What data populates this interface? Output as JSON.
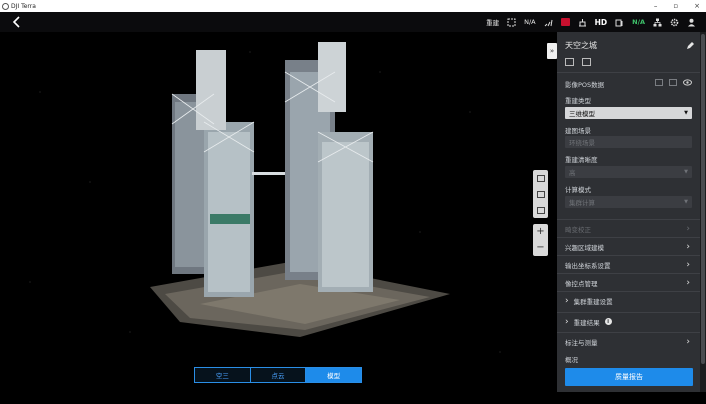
{
  "window": {
    "title": "DJI Terra",
    "controls": [
      "–",
      "▫",
      "×"
    ]
  },
  "appbar": {
    "rebuild_label": "重建",
    "status_1": "N/A",
    "hd_label": "HD",
    "status_2": "N/A",
    "icons": [
      "back-icon",
      "rtk-icon",
      "signal-icon",
      "battery-red-icon",
      "antenna-icon",
      "remote-icon",
      "network-icon",
      "gear-icon",
      "user-icon"
    ],
    "colors": {
      "warning": "#c8102e",
      "ok": "#3ec16a"
    }
  },
  "viewport": {
    "modes": [
      "空三",
      "点云",
      "模型"
    ],
    "active_mode": "模型"
  },
  "panel": {
    "title": "天空之城",
    "pos_data_label": "影像POS数据",
    "rebuild_type_label": "重建类型",
    "rebuild_type_value": "三维模型",
    "scene_label": "建图场景",
    "scene_value": "环绕场景",
    "resolution_label": "重建清晰度",
    "resolution_value": "高",
    "compute_label": "计算模式",
    "compute_value": "集群计算",
    "items": [
      {
        "label": "畸变校正",
        "enabled": false
      },
      {
        "label": "兴趣区域建模",
        "enabled": true
      },
      {
        "label": "输出坐标系设置",
        "enabled": true
      },
      {
        "label": "像控点管理",
        "enabled": true
      }
    ],
    "cluster_settings": "集群重建设置",
    "rebuild_results": "重建结果",
    "annotate": "标注与测量",
    "overview": "概况",
    "submit_label": "质量报告"
  },
  "colors": {
    "accent": "#1e8bea",
    "panel_bg": "#2e3034"
  }
}
